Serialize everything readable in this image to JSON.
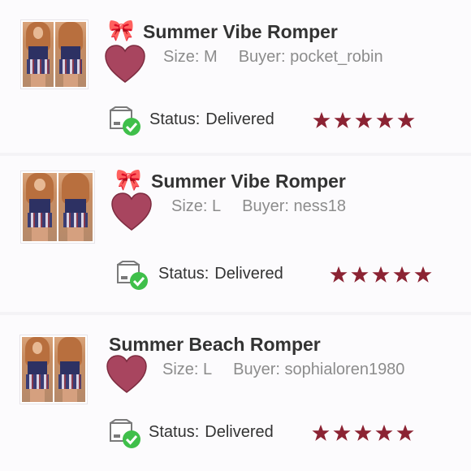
{
  "orders": [
    {
      "title": "Summer Vibe Romper",
      "bow": "🎀",
      "size_label": "Size:",
      "size": "M",
      "buyer_label": "Buyer:",
      "buyer": "pocket_robin",
      "status_label": "Status:",
      "status": "Delivered",
      "rating": 5
    },
    {
      "title": "Summer Vibe Romper",
      "bow": "🎀",
      "size_label": "Size:",
      "size": "L",
      "buyer_label": "Buyer:",
      "buyer": "ness18",
      "status_label": "Status:",
      "status": "Delivered",
      "rating": 5
    },
    {
      "title": "Summer Beach Romper",
      "size_label": "Size:",
      "size": "L",
      "buyer_label": "Buyer:",
      "buyer": "sophialoren1980",
      "status_label": "Status:",
      "status": "Delivered",
      "rating": 5
    }
  ],
  "colors": {
    "heart": "#a8455f",
    "star": "#8b2333",
    "check": "#3fbf4a"
  }
}
